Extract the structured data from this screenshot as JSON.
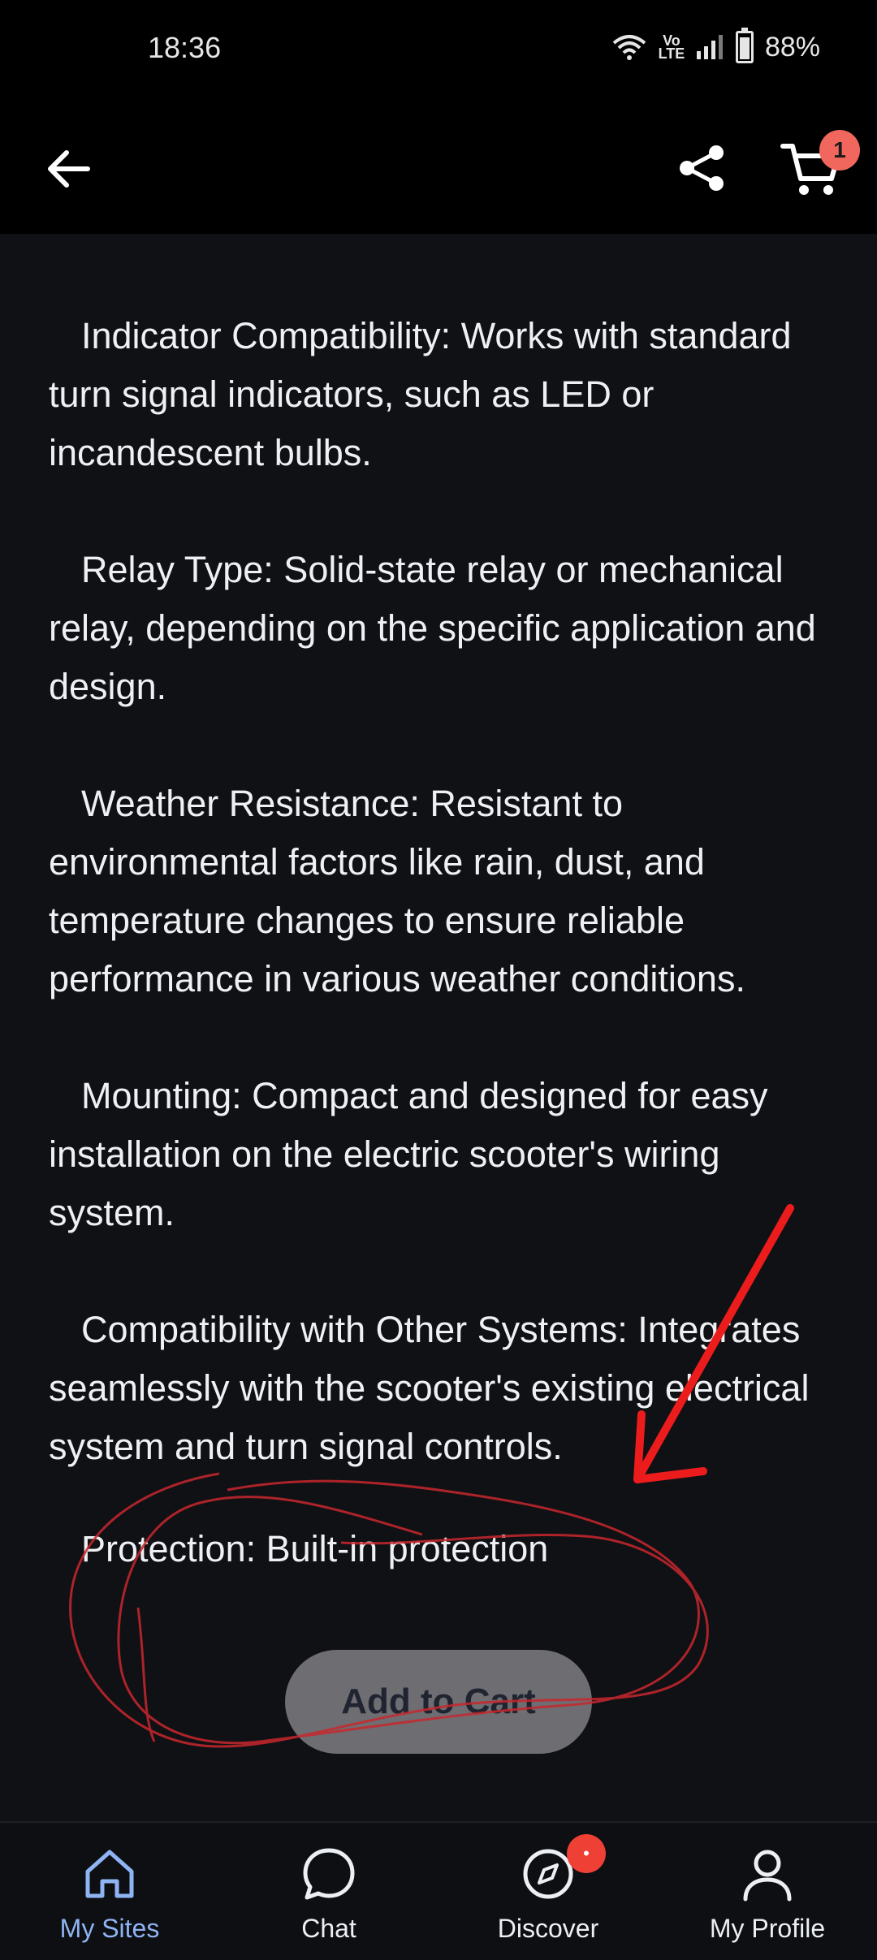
{
  "status_bar": {
    "time": "18:36",
    "network_label": "Vo LTE",
    "battery_text": "88%"
  },
  "app_bar": {
    "cart_count": "1"
  },
  "content": {
    "paragraphs": [
      "Indicator Compatibility: Works with standard turn signal indicators, such as LED or incandescent bulbs.",
      "Relay Type: Solid-state relay or mechanical relay, depending on the specific application and design.",
      "Weather Resistance: Resistant to environmental factors like rain, dust, and temperature changes to ensure reliable performance in various weather conditions.",
      "Mounting: Compact and designed for easy installation on the electric scooter's wiring system.",
      "Compatibility with Other Systems: Integrates seamlessly with the scooter's existing electrical system and turn signal controls.",
      "Protection: Built-in protection"
    ]
  },
  "add_to_cart_label": "Add to Cart",
  "bottom_nav": {
    "items": [
      {
        "label": "My Sites",
        "icon": "home-icon"
      },
      {
        "label": "Chat",
        "icon": "chat-icon"
      },
      {
        "label": "Discover",
        "icon": "compass-icon"
      },
      {
        "label": "My Profile",
        "icon": "person-icon"
      }
    ],
    "discover_badge": "•"
  },
  "colors": {
    "background": "#0f1115",
    "accent": "#8fb4f3",
    "badge": "#f2675d",
    "annotation": "#e8191d"
  }
}
